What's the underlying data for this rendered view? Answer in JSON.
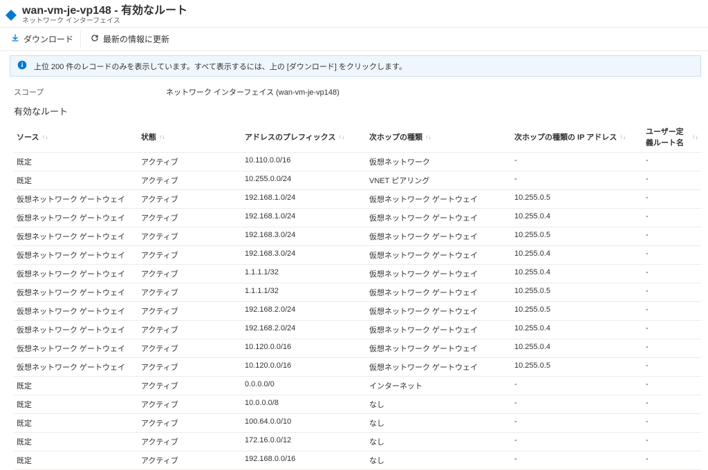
{
  "header": {
    "title": "wan-vm-je-vp148 - 有効なルート",
    "subtitle": "ネットワーク インターフェイス"
  },
  "toolbar": {
    "download": "ダウンロード",
    "refresh": "最新の情報に更新"
  },
  "info": {
    "text": "上位 200 件のレコードのみを表示しています。すべて表示するには、上の [ダウンロード] をクリックします。"
  },
  "scope": {
    "label": "スコープ",
    "value": "ネットワーク インターフェイス (wan-vm-je-vp148)"
  },
  "section": {
    "title": "有効なルート"
  },
  "columns": {
    "source": "ソース",
    "state": "状態",
    "prefix": "アドレスのプレフィックス",
    "hopType": "次ホップの種類",
    "hopIp": "次ホップの種類の IP アドレス",
    "udr": "ユーザー定義ルート名"
  },
  "rows": [
    {
      "source": "既定",
      "state": "アクティブ",
      "prefix": "10.110.0.0/16",
      "hopType": "仮想ネットワーク",
      "hopIp": "-",
      "udr": "-"
    },
    {
      "source": "既定",
      "state": "アクティブ",
      "prefix": "10.255.0.0/24",
      "hopType": "VNET ピアリング",
      "hopIp": "-",
      "udr": "-"
    },
    {
      "source": "仮想ネットワーク ゲートウェイ",
      "state": "アクティブ",
      "prefix": "192.168.1.0/24",
      "hopType": "仮想ネットワーク ゲートウェイ",
      "hopIp": "10.255.0.5",
      "udr": "-"
    },
    {
      "source": "仮想ネットワーク ゲートウェイ",
      "state": "アクティブ",
      "prefix": "192.168.1.0/24",
      "hopType": "仮想ネットワーク ゲートウェイ",
      "hopIp": "10.255.0.4",
      "udr": "-"
    },
    {
      "source": "仮想ネットワーク ゲートウェイ",
      "state": "アクティブ",
      "prefix": "192.168.3.0/24",
      "hopType": "仮想ネットワーク ゲートウェイ",
      "hopIp": "10.255.0.5",
      "udr": "-"
    },
    {
      "source": "仮想ネットワーク ゲートウェイ",
      "state": "アクティブ",
      "prefix": "192.168.3.0/24",
      "hopType": "仮想ネットワーク ゲートウェイ",
      "hopIp": "10.255.0.4",
      "udr": "-"
    },
    {
      "source": "仮想ネットワーク ゲートウェイ",
      "state": "アクティブ",
      "prefix": "1.1.1.1/32",
      "hopType": "仮想ネットワーク ゲートウェイ",
      "hopIp": "10.255.0.4",
      "udr": "-"
    },
    {
      "source": "仮想ネットワーク ゲートウェイ",
      "state": "アクティブ",
      "prefix": "1.1.1.1/32",
      "hopType": "仮想ネットワーク ゲートウェイ",
      "hopIp": "10.255.0.5",
      "udr": "-"
    },
    {
      "source": "仮想ネットワーク ゲートウェイ",
      "state": "アクティブ",
      "prefix": "192.168.2.0/24",
      "hopType": "仮想ネットワーク ゲートウェイ",
      "hopIp": "10.255.0.5",
      "udr": "-"
    },
    {
      "source": "仮想ネットワーク ゲートウェイ",
      "state": "アクティブ",
      "prefix": "192.168.2.0/24",
      "hopType": "仮想ネットワーク ゲートウェイ",
      "hopIp": "10.255.0.4",
      "udr": "-"
    },
    {
      "source": "仮想ネットワーク ゲートウェイ",
      "state": "アクティブ",
      "prefix": "10.120.0.0/16",
      "hopType": "仮想ネットワーク ゲートウェイ",
      "hopIp": "10.255.0.4",
      "udr": "-"
    },
    {
      "source": "仮想ネットワーク ゲートウェイ",
      "state": "アクティブ",
      "prefix": "10.120.0.0/16",
      "hopType": "仮想ネットワーク ゲートウェイ",
      "hopIp": "10.255.0.5",
      "udr": "-"
    },
    {
      "source": "既定",
      "state": "アクティブ",
      "prefix": "0.0.0.0/0",
      "hopType": "インターネット",
      "hopIp": "-",
      "udr": "-"
    },
    {
      "source": "既定",
      "state": "アクティブ",
      "prefix": "10.0.0.0/8",
      "hopType": "なし",
      "hopIp": "-",
      "udr": "-"
    },
    {
      "source": "既定",
      "state": "アクティブ",
      "prefix": "100.64.0.0/10",
      "hopType": "なし",
      "hopIp": "-",
      "udr": "-"
    },
    {
      "source": "既定",
      "state": "アクティブ",
      "prefix": "172.16.0.0/12",
      "hopType": "なし",
      "hopIp": "-",
      "udr": "-"
    },
    {
      "source": "既定",
      "state": "アクティブ",
      "prefix": "192.168.0.0/16",
      "hopType": "なし",
      "hopIp": "-",
      "udr": "-"
    }
  ]
}
